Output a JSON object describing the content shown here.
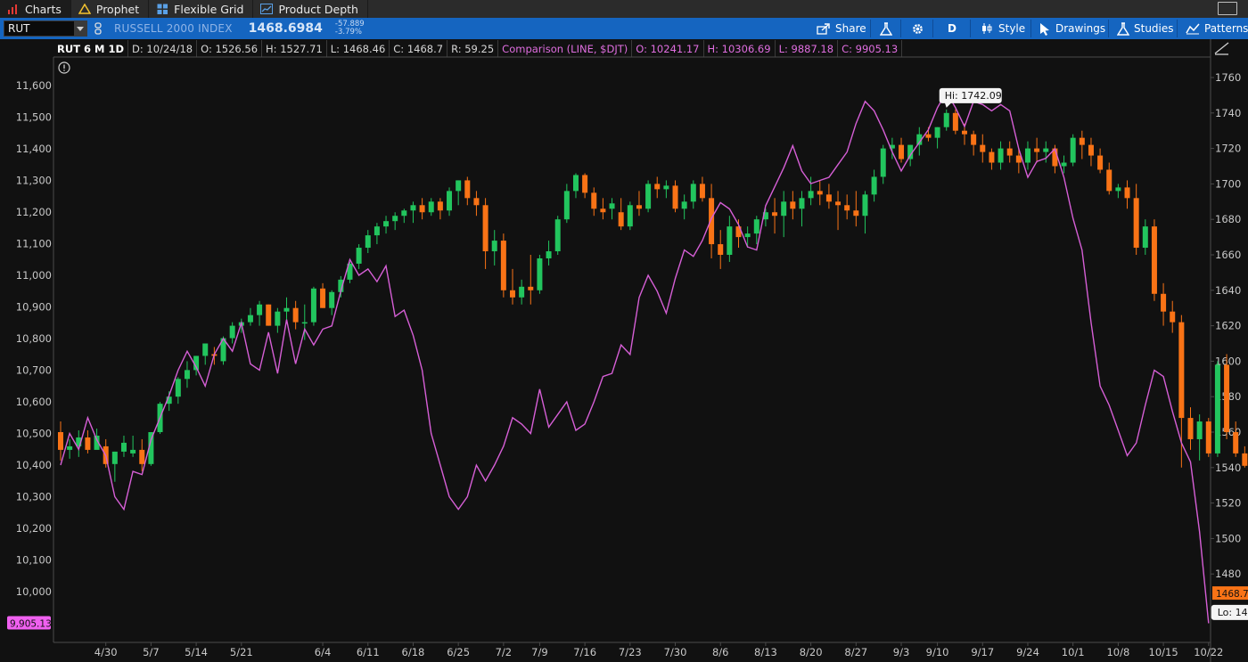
{
  "tabs": [
    {
      "label": "Charts",
      "icon": "bar-chart-icon",
      "active": true
    },
    {
      "label": "Prophet",
      "icon": "warning-triangle-icon",
      "active": false
    },
    {
      "label": "Flexible Grid",
      "icon": "grid-icon",
      "active": false
    },
    {
      "label": "Product Depth",
      "icon": "depth-chart-icon",
      "active": false
    }
  ],
  "toolbar": {
    "symbol": "RUT",
    "description": "RUSSELL 2000 INDEX",
    "last_price": "1468.6984",
    "net_change": "-57.889",
    "pct_change": "-3.79%",
    "buttons": {
      "share": "Share",
      "aggregation": "D",
      "style": "Style",
      "drawings": "Drawings",
      "studies": "Studies",
      "patterns": "Patterns"
    }
  },
  "info": {
    "label": "RUT 6 M 1D",
    "date": "D: 10/24/18",
    "open": "O: 1526.56",
    "high": "H: 1527.71",
    "low": "L: 1468.46",
    "close": "C: 1468.7",
    "range": "R: 59.25",
    "comp_label": "Comparison (LINE, $DJT)",
    "comp_open": "O: 10241.17",
    "comp_high": "H: 10306.69",
    "comp_low": "L: 9887.18",
    "comp_close": "C: 9905.13"
  },
  "colors": {
    "up": "#22c55e",
    "down": "#f97316",
    "comparison": "#d65fd6",
    "toolbar": "#1565c0",
    "last_price_tag": "#f97316",
    "comparison_tag": "#f060f0"
  },
  "chart_data": {
    "type": "candlestick",
    "right_axis": {
      "ylim": [
        1440,
        1770
      ],
      "ticks": [
        1460,
        1480,
        1500,
        1520,
        1540,
        1560,
        1580,
        1600,
        1620,
        1640,
        1660,
        1680,
        1700,
        1720,
        1740,
        1760
      ]
    },
    "left_axis": {
      "ylim": [
        9780,
        11720
      ],
      "ticks": [
        "10,000",
        "10,100",
        "10,200",
        "10,300",
        "10,400",
        "10,500",
        "10,600",
        "10,700",
        "10,800",
        "10,900",
        "11,000",
        "11,100",
        "11,200",
        "11,300",
        "11,400",
        "11,500",
        "11,600"
      ]
    },
    "x_labels": [
      {
        "i": 5,
        "label": "4/30"
      },
      {
        "i": 10,
        "label": "5/7"
      },
      {
        "i": 15,
        "label": "5/14"
      },
      {
        "i": 20,
        "label": "5/21"
      },
      {
        "i": 29,
        "label": "6/4"
      },
      {
        "i": 34,
        "label": "6/11"
      },
      {
        "i": 39,
        "label": "6/18"
      },
      {
        "i": 44,
        "label": "6/25"
      },
      {
        "i": 49,
        "label": "7/2"
      },
      {
        "i": 53,
        "label": "7/9"
      },
      {
        "i": 58,
        "label": "7/16"
      },
      {
        "i": 63,
        "label": "7/23"
      },
      {
        "i": 68,
        "label": "7/30"
      },
      {
        "i": 73,
        "label": "8/6"
      },
      {
        "i": 78,
        "label": "8/13"
      },
      {
        "i": 83,
        "label": "8/20"
      },
      {
        "i": 88,
        "label": "8/27"
      },
      {
        "i": 93,
        "label": "9/3"
      },
      {
        "i": 97,
        "label": "9/10"
      },
      {
        "i": 102,
        "label": "9/17"
      },
      {
        "i": 107,
        "label": "9/24"
      },
      {
        "i": 112,
        "label": "10/1"
      },
      {
        "i": 117,
        "label": "10/8"
      },
      {
        "i": 122,
        "label": "10/15"
      },
      {
        "i": 127,
        "label": "10/22"
      }
    ],
    "candles": [
      [
        1560,
        1566,
        1544,
        1550
      ],
      [
        1550,
        1556,
        1545,
        1552
      ],
      [
        1552,
        1561,
        1546,
        1557
      ],
      [
        1557,
        1561,
        1548,
        1550
      ],
      [
        1550,
        1562,
        1552,
        1558
      ],
      [
        1552,
        1556,
        1540,
        1542
      ],
      [
        1542,
        1549,
        1532,
        1549
      ],
      [
        1549,
        1558,
        1546,
        1554
      ],
      [
        1548,
        1558,
        1546,
        1550
      ],
      [
        1550,
        1556,
        1538,
        1542
      ],
      [
        1542,
        1560,
        1541,
        1560
      ],
      [
        1560,
        1577,
        1559,
        1576
      ],
      [
        1576,
        1583,
        1572,
        1580
      ],
      [
        1580,
        1591,
        1576,
        1590
      ],
      [
        1590,
        1600,
        1585,
        1595
      ],
      [
        1595,
        1603,
        1592,
        1603
      ],
      [
        1603,
        1610,
        1598,
        1610
      ],
      [
        1604,
        1608,
        1598,
        1603
      ],
      [
        1600,
        1614,
        1598,
        1613
      ],
      [
        1613,
        1622,
        1610,
        1620
      ],
      [
        1620,
        1624,
        1616,
        1622
      ],
      [
        1622,
        1630,
        1620,
        1626
      ],
      [
        1626,
        1634,
        1620,
        1632
      ],
      [
        1632,
        1632,
        1620,
        1620
      ],
      [
        1620,
        1630,
        1616,
        1628
      ],
      [
        1628,
        1636,
        1622,
        1630
      ],
      [
        1630,
        1634,
        1618,
        1622
      ],
      [
        1622,
        1632,
        1612,
        1622
      ],
      [
        1622,
        1642,
        1620,
        1641
      ],
      [
        1641,
        1644,
        1630,
        1630
      ],
      [
        1630,
        1640,
        1626,
        1639
      ],
      [
        1639,
        1648,
        1636,
        1646
      ],
      [
        1646,
        1656,
        1644,
        1655
      ],
      [
        1655,
        1666,
        1652,
        1664
      ],
      [
        1664,
        1674,
        1661,
        1671
      ],
      [
        1671,
        1678,
        1666,
        1676
      ],
      [
        1676,
        1682,
        1672,
        1679
      ],
      [
        1679,
        1684,
        1674,
        1682
      ],
      [
        1682,
        1686,
        1678,
        1685
      ],
      [
        1685,
        1690,
        1678,
        1688
      ],
      [
        1688,
        1692,
        1680,
        1684
      ],
      [
        1684,
        1692,
        1682,
        1690
      ],
      [
        1690,
        1692,
        1680,
        1685
      ],
      [
        1685,
        1698,
        1682,
        1696
      ],
      [
        1696,
        1702,
        1688,
        1702
      ],
      [
        1702,
        1704,
        1688,
        1692
      ],
      [
        1692,
        1696,
        1682,
        1688
      ],
      [
        1688,
        1692,
        1652,
        1662
      ],
      [
        1662,
        1674,
        1654,
        1668
      ],
      [
        1668,
        1672,
        1636,
        1640
      ],
      [
        1640,
        1652,
        1632,
        1636
      ],
      [
        1636,
        1646,
        1632,
        1642
      ],
      [
        1642,
        1660,
        1632,
        1640
      ],
      [
        1640,
        1660,
        1638,
        1658
      ],
      [
        1658,
        1668,
        1654,
        1662
      ],
      [
        1662,
        1682,
        1660,
        1680
      ],
      [
        1680,
        1700,
        1678,
        1696
      ],
      [
        1696,
        1706,
        1692,
        1705
      ],
      [
        1705,
        1706,
        1692,
        1695
      ],
      [
        1695,
        1698,
        1682,
        1686
      ],
      [
        1686,
        1692,
        1680,
        1684
      ],
      [
        1686,
        1692,
        1680,
        1689
      ],
      [
        1684,
        1692,
        1674,
        1676
      ],
      [
        1676,
        1690,
        1674,
        1688
      ],
      [
        1688,
        1696,
        1682,
        1686
      ],
      [
        1686,
        1702,
        1684,
        1700
      ],
      [
        1700,
        1704,
        1692,
        1697
      ],
      [
        1697,
        1702,
        1692,
        1699
      ],
      [
        1699,
        1702,
        1684,
        1686
      ],
      [
        1686,
        1694,
        1680,
        1690
      ],
      [
        1690,
        1702,
        1686,
        1700
      ],
      [
        1700,
        1704,
        1690,
        1692
      ],
      [
        1692,
        1700,
        1658,
        1666
      ],
      [
        1666,
        1674,
        1652,
        1660
      ],
      [
        1660,
        1682,
        1656,
        1676
      ],
      [
        1676,
        1680,
        1664,
        1670
      ],
      [
        1670,
        1676,
        1664,
        1672
      ],
      [
        1672,
        1682,
        1666,
        1680
      ],
      [
        1680,
        1686,
        1676,
        1684
      ],
      [
        1684,
        1692,
        1672,
        1682
      ],
      [
        1682,
        1696,
        1670,
        1690
      ],
      [
        1690,
        1696,
        1680,
        1686
      ],
      [
        1686,
        1696,
        1676,
        1692
      ],
      [
        1692,
        1704,
        1688,
        1696
      ],
      [
        1696,
        1702,
        1688,
        1694
      ],
      [
        1694,
        1700,
        1686,
        1690
      ],
      [
        1690,
        1696,
        1674,
        1688
      ],
      [
        1688,
        1694,
        1680,
        1685
      ],
      [
        1685,
        1696,
        1676,
        1682
      ],
      [
        1682,
        1696,
        1672,
        1694
      ],
      [
        1694,
        1708,
        1690,
        1704
      ],
      [
        1704,
        1722,
        1700,
        1720
      ],
      [
        1720,
        1726,
        1714,
        1722
      ],
      [
        1722,
        1726,
        1712,
        1714
      ],
      [
        1714,
        1722,
        1710,
        1722
      ],
      [
        1722,
        1732,
        1716,
        1728
      ],
      [
        1728,
        1732,
        1724,
        1726
      ],
      [
        1726,
        1732,
        1720,
        1732
      ],
      [
        1732,
        1742,
        1730,
        1740
      ],
      [
        1740,
        1742,
        1728,
        1730
      ],
      [
        1730,
        1734,
        1722,
        1728
      ],
      [
        1728,
        1730,
        1716,
        1722
      ],
      [
        1722,
        1728,
        1712,
        1718
      ],
      [
        1718,
        1720,
        1708,
        1712
      ],
      [
        1712,
        1724,
        1708,
        1720
      ],
      [
        1720,
        1724,
        1712,
        1716
      ],
      [
        1716,
        1720,
        1706,
        1712
      ],
      [
        1712,
        1724,
        1708,
        1720
      ],
      [
        1720,
        1726,
        1712,
        1718
      ],
      [
        1718,
        1724,
        1712,
        1720
      ],
      [
        1720,
        1722,
        1706,
        1710
      ],
      [
        1710,
        1716,
        1706,
        1712
      ],
      [
        1712,
        1728,
        1710,
        1726
      ],
      [
        1726,
        1730,
        1714,
        1722
      ],
      [
        1722,
        1726,
        1710,
        1716
      ],
      [
        1716,
        1720,
        1706,
        1708
      ],
      [
        1708,
        1712,
        1694,
        1696
      ],
      [
        1696,
        1700,
        1692,
        1698
      ],
      [
        1698,
        1702,
        1686,
        1692
      ],
      [
        1692,
        1700,
        1660,
        1664
      ],
      [
        1664,
        1680,
        1660,
        1676
      ],
      [
        1676,
        1680,
        1634,
        1638
      ],
      [
        1638,
        1644,
        1620,
        1628
      ],
      [
        1628,
        1634,
        1616,
        1622
      ],
      [
        1622,
        1626,
        1540,
        1568
      ],
      [
        1568,
        1574,
        1550,
        1556
      ],
      [
        1556,
        1570,
        1544,
        1566
      ],
      [
        1566,
        1568,
        1546,
        1548
      ],
      [
        1548,
        1600,
        1546,
        1598
      ],
      [
        1598,
        1604,
        1556,
        1560
      ],
      [
        1560,
        1566,
        1546,
        1548
      ],
      [
        1548,
        1552,
        1540,
        1541
      ],
      [
        1541,
        1546,
        1530,
        1534
      ],
      [
        1534,
        1536,
        1514,
        1526
      ],
      [
        1526,
        1528,
        1452,
        1469
      ]
    ],
    "comparison_series": {
      "name": "$DJT",
      "values": [
        10400,
        10500,
        10450,
        10550,
        10480,
        10430,
        10300,
        10260,
        10380,
        10370,
        10480,
        10550,
        10620,
        10700,
        10760,
        10710,
        10650,
        10750,
        10800,
        10760,
        10850,
        10720,
        10700,
        10820,
        10690,
        10860,
        10720,
        10830,
        10780,
        10830,
        10840,
        10950,
        11050,
        11000,
        11020,
        10980,
        11030,
        10870,
        10890,
        10810,
        10700,
        10500,
        10400,
        10300,
        10260,
        10300,
        10400,
        10350,
        10400,
        10460,
        10550,
        10530,
        10500,
        10640,
        10520,
        10560,
        10600,
        10510,
        10530,
        10600,
        10680,
        10690,
        10780,
        10750,
        10930,
        11000,
        10950,
        10880,
        10990,
        11080,
        11060,
        11110,
        11180,
        11230,
        11210,
        11160,
        11090,
        11080,
        11220,
        11280,
        11340,
        11410,
        11330,
        11290,
        11300,
        11310,
        11350,
        11390,
        11480,
        11550,
        11520,
        11460,
        11390,
        11330,
        11380,
        11420,
        11460,
        11530,
        11580,
        11530,
        11470,
        11550,
        11540,
        11520,
        11540,
        11520,
        11400,
        11310,
        11360,
        11370,
        11400,
        11310,
        11180,
        11080,
        10850,
        10650,
        10590,
        10510,
        10430,
        10470,
        10590,
        10700,
        10680,
        10570,
        10470,
        10410,
        10190,
        9900
      ]
    },
    "hi_label": "Hi: 1742.09",
    "lo_label": "Lo: 1468.46",
    "last_price_tag": "1468.7",
    "comparison_tag": "9,905.13"
  }
}
